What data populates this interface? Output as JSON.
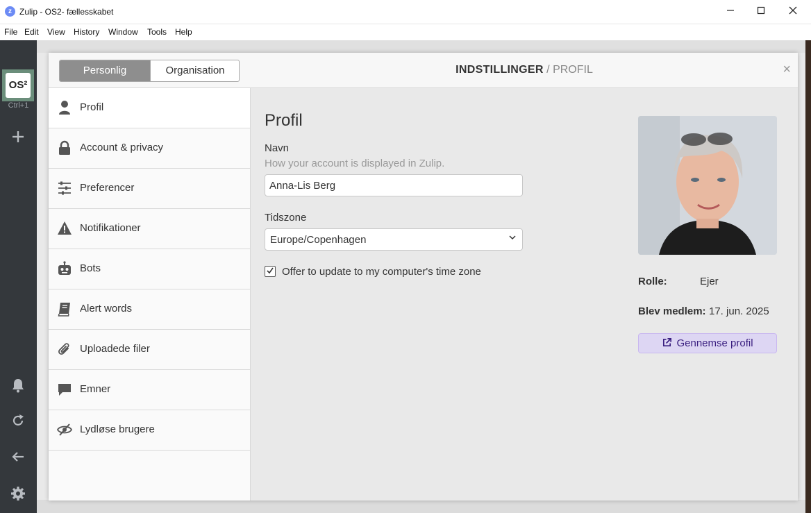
{
  "window": {
    "title": "Zulip - OS2- fællesskabet",
    "app_icon": "zulip-icon",
    "controls": {
      "minimize": "—",
      "maximize": "☐",
      "close": "✕"
    }
  },
  "menubar": [
    "File",
    "Edit",
    "View",
    "History",
    "Window",
    "Tools",
    "Help"
  ],
  "sidebar": {
    "org_logo_text": "OS²",
    "org_shortcut": "Ctrl+1",
    "icons": [
      "plus-icon",
      "bell-icon",
      "reload-icon",
      "back-arrow-icon",
      "gear-icon"
    ]
  },
  "modal": {
    "tabs": {
      "personal": "Personlig",
      "organisation": "Organisation"
    },
    "title_main": "INDSTILLINGER",
    "title_sep": " / ",
    "title_sub": "PROFIL",
    "close": "×"
  },
  "nav": [
    {
      "label": "Profil",
      "icon": "user-icon",
      "active": true
    },
    {
      "label": "Account & privacy",
      "icon": "lock-icon"
    },
    {
      "label": "Preferencer",
      "icon": "sliders-icon"
    },
    {
      "label": "Notifikationer",
      "icon": "warning-icon"
    },
    {
      "label": "Bots",
      "icon": "robot-icon"
    },
    {
      "label": "Alert words",
      "icon": "book-icon"
    },
    {
      "label": "Uploadede filer",
      "icon": "paperclip-icon"
    },
    {
      "label": "Emner",
      "icon": "comment-icon"
    },
    {
      "label": "Lydløse brugere",
      "icon": "eye-slash-icon"
    }
  ],
  "profile": {
    "heading": "Profil",
    "name_label": "Navn",
    "name_hint": "How your account is displayed in Zulip.",
    "name_value": "Anna-Lis Berg",
    "timezone_label": "Tidszone",
    "timezone_value": "Europe/Copenhagen",
    "checkbox_checked": true,
    "checkbox_label": "Offer to update to my computer's time zone",
    "role_label": "Rolle:",
    "role_value": "Ejer",
    "joined_label": "Blev medlem:",
    "joined_value": "17. jun. 2025",
    "view_profile_button": "Gennemse profil"
  },
  "colors": {
    "sidebar_bg": "#34383c",
    "org_tile": "#6b8e7b",
    "tab_active": "#8e8e8e",
    "button_bg": "#ddd6f3",
    "button_text": "#3a1f80"
  }
}
